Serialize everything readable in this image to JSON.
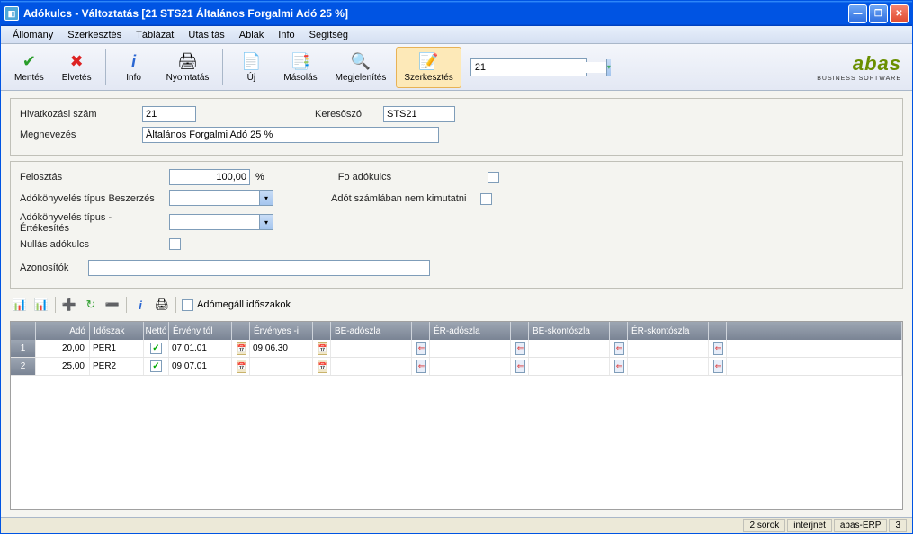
{
  "title": "Adókulcs - Változtatás  [21   STS21   Általános Forgalmi Adó 25 %]",
  "menu": {
    "allomany": "Állomány",
    "szerkesztes": "Szerkesztés",
    "tablazat": "Táblázat",
    "utasitas": "Utasítás",
    "ablak": "Ablak",
    "info": "Info",
    "segitseg": "Segítség"
  },
  "toolbar": {
    "mentes": "Mentés",
    "elvetes": "Elvetés",
    "info": "Info",
    "nyomtatas": "Nyomtatás",
    "uj": "Új",
    "masolas": "Másolás",
    "megjelenites": "Megjelenítés",
    "szerkesztes": "Szerkesztés",
    "search_value": "21"
  },
  "logo": {
    "brand": "abas",
    "tag": "BUSINESS SOFTWARE"
  },
  "form": {
    "hivatk_label": "Hivatkozási szám",
    "hivatk_value": "21",
    "keresoszo_label": "Keresőszó",
    "keresoszo_value": "STS21",
    "megnevezes_label": "Megnevezés",
    "megnevezes_value": "Általános Forgalmi Adó 25 %",
    "felosztas_label": "Felosztás",
    "felosztas_value": "100,00",
    "felosztas_unit": "%",
    "fo_adokulcs_label": "Fo adókulcs",
    "adokbesz_label": "Adókönyvelés típus Beszerzés",
    "adot_szaml_label": "Adót számlában nem kimutatni",
    "adokert_label": "Adókönyvelés típus - Értékesítés",
    "nullas_label": "Nullás adókulcs",
    "azonositok_label": "Azonosítók"
  },
  "mini": {
    "adomegall": "Adómegáll időszakok"
  },
  "grid": {
    "headers": {
      "ado": "Adó",
      "idoszak": "Időszak",
      "netto": "Nettó",
      "erveny_tol": "Érvény tól",
      "ervenyes_i": "Érvényes -i",
      "be_adoszla": "BE-adószla",
      "er_adoszla": "ÉR-adószla",
      "be_skontoszla": "BE-skontószla",
      "er_skontoszla": "ÉR-skontószla"
    },
    "rows": [
      {
        "n": "1",
        "ado": "20,00",
        "idoszak": "PER1",
        "netto": true,
        "erv_tol": "07.01.01",
        "erv_i": "09.06.30",
        "be_ad": "",
        "er_ad": "",
        "be_sk": "",
        "er_sk": ""
      },
      {
        "n": "2",
        "ado": "25,00",
        "idoszak": "PER2",
        "netto": true,
        "erv_tol": "09.07.01",
        "erv_i": "",
        "be_ad": "",
        "er_ad": "",
        "be_sk": "",
        "er_sk": ""
      }
    ]
  },
  "status": {
    "sorok": "2 sorok",
    "internet": "interjnet",
    "abas": "abas-ERP",
    "n": "3"
  }
}
